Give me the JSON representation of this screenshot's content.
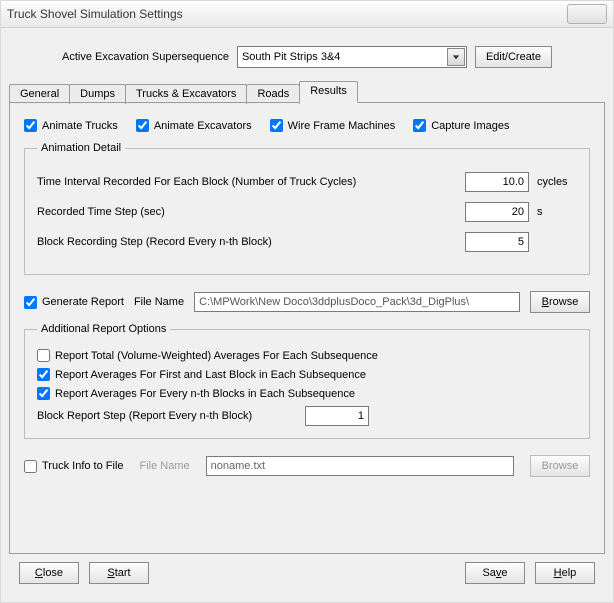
{
  "window": {
    "title": "Truck Shovel Simulation Settings"
  },
  "header": {
    "supersequence_label": "Active Excavation Supersequence",
    "supersequence_value": "South Pit Strips 3&4",
    "edit_create": "Edit/Create"
  },
  "tabs": [
    "General",
    "Dumps",
    "Trucks & Excavators",
    "Roads",
    "Results"
  ],
  "results": {
    "top_checks": [
      "Animate Trucks",
      "Animate Excavators",
      "Wire Frame Machines",
      "Capture Images"
    ],
    "animation_detail": {
      "legend": "Animation Detail",
      "time_interval_label": "Time Interval Recorded For Each Block (Number of Truck Cycles)",
      "time_interval_value": "10.0",
      "time_interval_unit": "cycles",
      "recorded_step_label": "Recorded Time Step (sec)",
      "recorded_step_value": "20",
      "recorded_step_unit": "s",
      "block_recording_label": "Block Recording Step (Record Every n-th Block)",
      "block_recording_value": "5"
    },
    "generate_report": {
      "label": "Generate Report",
      "file_name_label": "File Name",
      "file_name_value": "C:\\MPWork\\New Doco\\3ddplusDoco_Pack\\3d_DigPlus\\",
      "browse_underline": "B",
      "browse_rest": "rowse"
    },
    "additional_report": {
      "legend": "Additional Report Options",
      "opts": [
        "Report Total (Volume-Weighted) Averages For Each Subsequence",
        "Report Averages For First and Last Block in Each Subsequence",
        "Report Averages For Every n-th Blocks in Each Subsequence"
      ],
      "block_report_step_label": "Block Report Step (Report Every n-th Block)",
      "block_report_step_value": "1"
    },
    "truck_info": {
      "label": "Truck Info to File",
      "file_name_label": "File Name",
      "file_name_value": "noname.txt",
      "browse": "Browse"
    }
  },
  "footer": {
    "close_u": "C",
    "close_r": "lose",
    "start_u": "S",
    "start_r": "tart",
    "save_l": "Sa",
    "save_u": "v",
    "save_r": "e",
    "help_u": "H",
    "help_r": "elp"
  }
}
